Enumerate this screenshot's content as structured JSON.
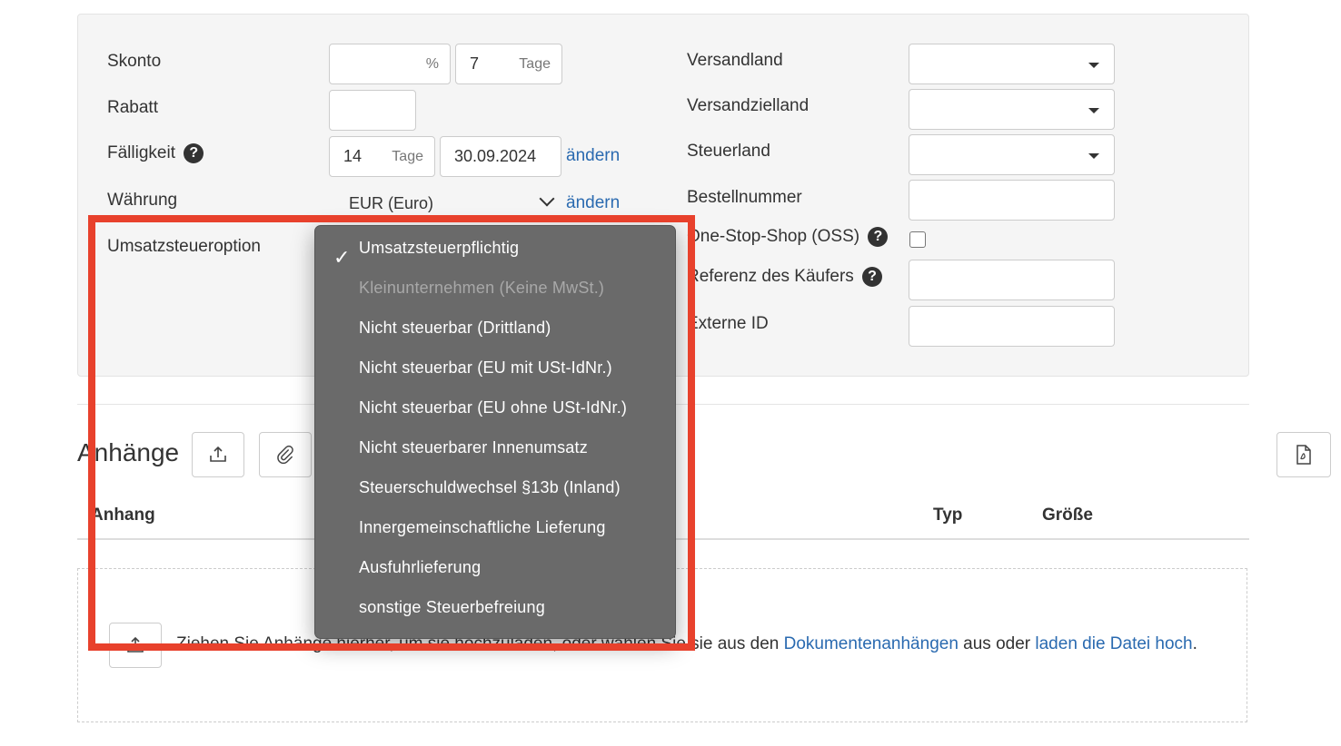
{
  "left_form": {
    "skonto_label": "Skonto",
    "skonto_percent_unit": "%",
    "skonto_days_value": "7",
    "skonto_days_unit": "Tage",
    "rabatt_label": "Rabatt",
    "faelligkeit_label": "Fälligkeit",
    "faelligkeit_days_value": "14",
    "faelligkeit_days_unit": "Tage",
    "faelligkeit_date": "30.09.2024",
    "faelligkeit_change": "ändern",
    "waehrung_label": "Währung",
    "waehrung_value": "EUR (Euro)",
    "waehrung_change": "ändern",
    "ust_option_label": "Umsatzsteueroption",
    "help_glyph": "?"
  },
  "right_form": {
    "versandland_label": "Versandland",
    "versandzielland_label": "Versandzielland",
    "steuerland_label": "Steuerland",
    "bestellnummer_label": "Bestellnummer",
    "oss_label": "One-Stop-Shop (OSS)",
    "referenz_label": "Referenz des Käufers",
    "externe_id_label": "Externe ID"
  },
  "attachments": {
    "heading": "Anhänge",
    "col_anhang": "Anhang",
    "col_typ": "Typ",
    "col_groesse": "Größe",
    "drop_text_prefix": "Ziehen Sie Anhänge hierher, um sie hochzuladen, oder wählen Sie sie aus den ",
    "drop_link_docs": "Dokumentenanhängen",
    "drop_text_middle": " aus oder ",
    "drop_link_upload": "laden die Datei hoch",
    "drop_text_suffix": "."
  },
  "dropdown": {
    "checkmark": "✓",
    "options": [
      {
        "label": "Umsatzsteuerpflichtig",
        "selected": true,
        "disabled": false
      },
      {
        "label": "Kleinunternehmen (Keine MwSt.)",
        "selected": false,
        "disabled": true
      },
      {
        "label": "Nicht steuerbar (Drittland)",
        "selected": false,
        "disabled": false
      },
      {
        "label": "Nicht steuerbar (EU mit USt-IdNr.)",
        "selected": false,
        "disabled": false
      },
      {
        "label": "Nicht steuerbar (EU ohne USt-IdNr.)",
        "selected": false,
        "disabled": false
      },
      {
        "label": "Nicht steuerbarer Innenumsatz",
        "selected": false,
        "disabled": false
      },
      {
        "label": "Steuerschuldwechsel §13b (Inland)",
        "selected": false,
        "disabled": false
      },
      {
        "label": "Innergemeinschaftliche Lieferung",
        "selected": false,
        "disabled": false
      },
      {
        "label": "Ausfuhrlieferung",
        "selected": false,
        "disabled": false
      },
      {
        "label": "sonstige Steuerbefreiung",
        "selected": false,
        "disabled": false
      }
    ]
  },
  "colors": {
    "link": "#2a6ab0",
    "highlight": "#e8412c",
    "dropdown_bg": "#6a6a6a"
  }
}
